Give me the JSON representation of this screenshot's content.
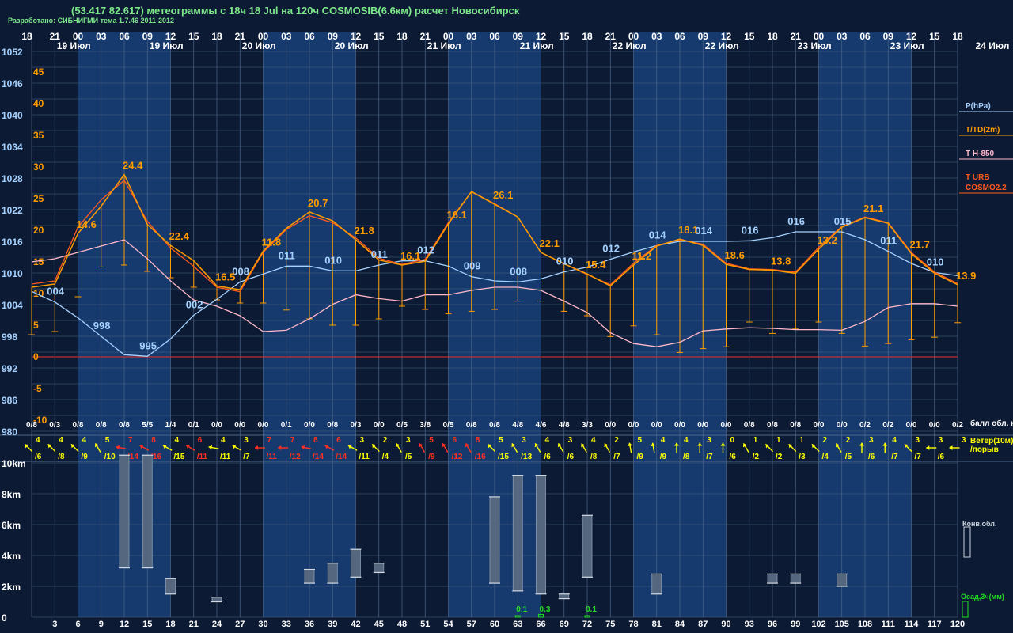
{
  "header": {
    "title": "(53.417 82.617) метеограммы с  18ч 18 Jul на 120ч COSMOSIB(6.6км) расчет Новосибирск",
    "credit": "Разработано: СИБНИГМИ тема 1.7.46 2011-2012"
  },
  "colors": {
    "background": "#0d1a33",
    "band": "#163a6e",
    "grid": "#4d6688",
    "pressure": "#a6d2ff",
    "temperature": "#ff9c00",
    "t850": "#ffb8c8",
    "zero_line": "#c03030",
    "wind_normal": "#ffff00",
    "wind_strong": "#ff3020",
    "precip": "#20e020",
    "text": "#ffffff"
  },
  "chart_data": [
    {
      "name": "meteogram-upper",
      "type": "line",
      "hour_labels": [
        "18",
        "21",
        "00",
        "03",
        "06",
        "09",
        "12",
        "15",
        "18",
        "21",
        "00",
        "03",
        "06",
        "09",
        "12",
        "15",
        "18",
        "21",
        "00",
        "03",
        "06",
        "09",
        "12",
        "15",
        "18",
        "21",
        "00",
        "03",
        "06",
        "09",
        "12",
        "15",
        "18",
        "21",
        "00",
        "03",
        "06",
        "09",
        "12",
        "15",
        "18"
      ],
      "date_labels": [
        "19 Июл",
        "19 Июл",
        "20 Июл",
        "20 Июл",
        "21 Июл",
        "21 Июл",
        "22 Июл",
        "22 Июл",
        "23 Июл",
        "23 Июл",
        "24 Июл"
      ],
      "pressure_ticks": [
        "1052",
        "1046",
        "1040",
        "1034",
        "1028",
        "1022",
        "1016",
        "1010",
        "1004",
        "998",
        "992",
        "986",
        "980"
      ],
      "temperature_ticks": [
        "45",
        "40",
        "35",
        "30",
        "25",
        "20",
        "15",
        "10",
        "5",
        "0",
        "-5",
        "-10"
      ],
      "lead_hours": [
        0,
        3,
        6,
        9,
        12,
        15,
        18,
        21,
        24,
        27,
        30,
        33,
        36,
        39,
        42,
        45,
        48,
        51,
        54,
        57,
        60,
        63,
        66,
        69,
        72,
        75,
        78,
        81,
        84,
        87,
        90,
        93,
        96,
        99,
        102,
        105,
        108,
        111,
        114,
        117,
        120
      ],
      "series": [
        {
          "key": "pressure",
          "unit": "hPa",
          "values": [
            1006.5,
            1004.5,
            1001.5,
            998,
            994.5,
            994.2,
            997.5,
            1002,
            1005,
            1008.3,
            1009.8,
            1011.3,
            1011.3,
            1010.4,
            1010.4,
            1011.5,
            1012.3,
            1012.3,
            1011.3,
            1009.3,
            1008.5,
            1008.3,
            1008.9,
            1010.2,
            1011.1,
            1012.6,
            1014,
            1015.2,
            1016,
            1016,
            1016,
            1016.1,
            1016.7,
            1017.8,
            1017.8,
            1017.8,
            1016.3,
            1014.1,
            1011.8,
            1010.1,
            1009.5
          ],
          "labels": [
            {
              "i": 1,
              "t": "004"
            },
            {
              "i": 3,
              "t": "998"
            },
            {
              "i": 5,
              "t": "995"
            },
            {
              "i": 7,
              "t": "002"
            },
            {
              "i": 9,
              "t": "008"
            },
            {
              "i": 11,
              "t": "011"
            },
            {
              "i": 13,
              "t": "010"
            },
            {
              "i": 15,
              "t": "011"
            },
            {
              "i": 17,
              "t": "012"
            },
            {
              "i": 19,
              "t": "009"
            },
            {
              "i": 21,
              "t": "008"
            },
            {
              "i": 23,
              "t": "010"
            },
            {
              "i": 25,
              "t": "012"
            },
            {
              "i": 27,
              "t": "014"
            },
            {
              "i": 29,
              "t": "014"
            },
            {
              "i": 31,
              "t": "016"
            },
            {
              "i": 33,
              "t": "016"
            },
            {
              "i": 35,
              "t": "015"
            },
            {
              "i": 37,
              "t": "011"
            },
            {
              "i": 39,
              "t": "010"
            }
          ]
        },
        {
          "key": "temperature",
          "name": "T/TD(2m)",
          "unit": "C",
          "values": [
            11,
            11.5,
            19.5,
            23.8,
            28.8,
            20.9,
            17.6,
            15.2,
            11.2,
            10.6,
            16.7,
            20.3,
            22.9,
            21.5,
            18.5,
            15.3,
            14.5,
            15.1,
            21,
            26.1,
            24.1,
            22.1,
            16.5,
            14.7,
            13.1,
            11.2,
            14.5,
            17.5,
            18.6,
            17.6,
            14.6,
            13.8,
            13.7,
            13.2,
            17,
            20.5,
            22,
            21.1,
            16.3,
            13.2,
            11.4
          ],
          "labels": [
            {
              "i": 2,
              "t": "14.6"
            },
            {
              "i": 4,
              "t": "24.4"
            },
            {
              "i": 6,
              "t": "22.4"
            },
            {
              "i": 8,
              "t": "16.5"
            },
            {
              "i": 10,
              "t": "11.8"
            },
            {
              "i": 12,
              "t": "20.7"
            },
            {
              "i": 14,
              "t": "21.8"
            },
            {
              "i": 16,
              "t": "16.1"
            },
            {
              "i": 18,
              "t": "16.1"
            },
            {
              "i": 20,
              "t": "26.1"
            },
            {
              "i": 22,
              "t": "22.1"
            },
            {
              "i": 24,
              "t": "15.4"
            },
            {
              "i": 26,
              "t": "11.2"
            },
            {
              "i": 28,
              "t": "18.1"
            },
            {
              "i": 30,
              "t": "18.6"
            },
            {
              "i": 32,
              "t": "13.8"
            },
            {
              "i": 34,
              "t": "13.2"
            },
            {
              "i": 36,
              "t": "21.1"
            },
            {
              "i": 38,
              "t": "21.7"
            },
            {
              "i": 40,
              "t": "13.9"
            }
          ]
        },
        {
          "key": "t_urb",
          "name": "T URB",
          "unit": "C",
          "values": [
            11.5,
            12,
            20.5,
            24.8,
            27.9,
            21.4,
            17.2,
            14.3,
            11,
            10.3,
            16.5,
            20.1,
            22.3,
            21.2,
            18.8,
            15.6,
            14.6,
            15.4,
            21.2,
            26.1,
            24.2,
            22.1,
            16.5,
            14.7,
            13,
            11.4,
            14.8,
            17.6,
            18.5,
            17.8,
            14.8,
            13.9,
            13.8,
            13.4,
            17.3,
            20.6,
            22.1,
            21.2,
            16.5,
            13.4,
            11.6
          ]
        },
        {
          "key": "t850",
          "name": "T H-850",
          "unit": "C",
          "values": [
            15,
            15.5,
            16.5,
            17.5,
            18.5,
            15.5,
            12,
            9,
            8,
            6.5,
            4,
            4.2,
            6,
            8.3,
            9.8,
            9.2,
            8.8,
            9.8,
            9.8,
            10.5,
            11,
            11,
            10.5,
            8.8,
            7,
            3.8,
            2.1,
            1.6,
            2.3,
            4.1,
            4.4,
            4.6,
            4.5,
            4.3,
            4.3,
            4.2,
            5.6,
            7.8,
            8.4,
            8.4,
            8
          ]
        },
        {
          "key": "dew_point",
          "name": "TD",
          "unit": "C",
          "values": [
            3.5,
            4,
            9.5,
            14.2,
            14.5,
            13.5,
            12.5,
            11,
            9,
            8.5,
            8.5,
            7.4,
            6,
            5,
            5,
            6,
            8,
            7.5,
            6.8,
            7.2,
            7.5,
            8.8,
            8.8,
            7.2,
            6.5,
            3.2,
            4.9,
            3.5,
            0.7,
            1.3,
            1.6,
            5.5,
            3.7,
            4.4,
            5.5,
            3.7,
            1.7,
            2.1,
            2.7,
            3.1,
            5.4
          ]
        }
      ],
      "legend": [
        "P(hPa)",
        "T/TD(2m)",
        "T H-850",
        "T URB",
        "COSMO2.2"
      ],
      "ylim_pressure": [
        980,
        1055
      ],
      "ylim_temperature": [
        -10,
        45
      ]
    },
    {
      "name": "cloud-and-wind",
      "type": "table",
      "cloud_cover": [
        "0/8",
        "0/3",
        "0/8",
        "0/8",
        "0/8",
        "5/5",
        "1/4",
        "0/1",
        "0/0",
        "0/0",
        "0/0",
        "0/1",
        "0/0",
        "0/8",
        "0/3",
        "0/0",
        "0/5",
        "3/8",
        "0/5",
        "0/8",
        "0/8",
        "4/8",
        "4/6",
        "4/8",
        "3/3",
        "0/0",
        "0/0",
        "0/0",
        "0/0",
        "0/0",
        "0/0",
        "0/8",
        "0/8",
        "0/8",
        "0/0",
        "0/0",
        "0/2",
        "0/2",
        "0/0",
        "0/0",
        "0/2"
      ],
      "cloud_label": "балл обл. ниж/общ",
      "wind_speed": [
        "4",
        "4",
        "4",
        "5",
        "7",
        "8",
        "4",
        "6",
        "4",
        "3",
        "7",
        "7",
        "8",
        "6",
        "3",
        "2",
        "3",
        "5",
        "6",
        "8",
        "5",
        "3",
        "4",
        "3",
        "4",
        "2",
        "5",
        "4",
        "4",
        "3",
        "0",
        "1",
        "1",
        "1",
        "2",
        "2",
        "3",
        "4",
        "3",
        "3",
        "3"
      ],
      "wind_gust": [
        "/6",
        "/8",
        "/9",
        "/10",
        "/14",
        "/16",
        "/15",
        "/11",
        "/11",
        "/7",
        "/11",
        "/12",
        "/14",
        "/14",
        "/11",
        "/4",
        "/5",
        "/9",
        "/12",
        "/16",
        "/15",
        "/13",
        "/6",
        "/6",
        "/8",
        "/7",
        "/9",
        "/9",
        "/8",
        "/7",
        "/6",
        "/2",
        "/2",
        "/3",
        "/4",
        "/5",
        "/6",
        "/7",
        "/7",
        "/6"
      ],
      "wind_dir_deg": [
        315,
        315,
        315,
        330,
        280,
        300,
        300,
        300,
        280,
        300,
        270,
        270,
        280,
        300,
        300,
        315,
        330,
        330,
        330,
        330,
        315,
        330,
        330,
        330,
        330,
        330,
        350,
        350,
        0,
        0,
        0,
        330,
        315,
        315,
        315,
        330,
        0,
        0,
        315,
        270,
        270
      ],
      "wind_strong": [
        0,
        0,
        0,
        0,
        1,
        1,
        0,
        1,
        0,
        0,
        1,
        1,
        1,
        1,
        0,
        0,
        0,
        1,
        1,
        1,
        0,
        0,
        0,
        0,
        0,
        0,
        0,
        0,
        0,
        0,
        0,
        0,
        0,
        0,
        0,
        0,
        0,
        0,
        0,
        0,
        0
      ],
      "wind_label": "Ветер(10м) /порыв"
    },
    {
      "name": "convective-clouds",
      "type": "bar",
      "height_ticks": [
        "10km",
        "8km",
        "6km",
        "4km",
        "2km",
        "0"
      ],
      "step_labels": [
        "3",
        "6",
        "9",
        "12",
        "15",
        "18",
        "21",
        "24",
        "27",
        "30",
        "33",
        "36",
        "39",
        "42",
        "45",
        "48",
        "51",
        "54",
        "57",
        "60",
        "63",
        "66",
        "69",
        "72",
        "75",
        "78",
        "81",
        "84",
        "87",
        "90",
        "93",
        "96",
        "99",
        "102",
        "105",
        "108",
        "111",
        "114",
        "117",
        "120"
      ],
      "clouds": [
        {
          "hour": 12,
          "base_km": 3.2,
          "top_km": 10.5
        },
        {
          "hour": 15,
          "base_km": 3.2,
          "top_km": 10.5
        },
        {
          "hour": 18,
          "base_km": 1.5,
          "top_km": 2.5
        },
        {
          "hour": 24,
          "base_km": 1,
          "top_km": 1.3
        },
        {
          "hour": 36,
          "base_km": 2.2,
          "top_km": 3.1
        },
        {
          "hour": 39,
          "base_km": 2.2,
          "top_km": 3.5
        },
        {
          "hour": 42,
          "base_km": 2.6,
          "top_km": 4.4
        },
        {
          "hour": 45,
          "base_km": 2.9,
          "top_km": 3.5
        },
        {
          "hour": 60,
          "base_km": 2.2,
          "top_km": 7.8
        },
        {
          "hour": 63,
          "base_km": 1.7,
          "top_km": 9.2
        },
        {
          "hour": 66,
          "base_km": 1.5,
          "top_km": 9.2
        },
        {
          "hour": 69,
          "base_km": 1.2,
          "top_km": 1.5
        },
        {
          "hour": 72,
          "base_km": 2.6,
          "top_km": 6.6
        },
        {
          "hour": 81,
          "base_km": 1.5,
          "top_km": 2.8
        },
        {
          "hour": 96,
          "base_km": 2.2,
          "top_km": 2.8
        },
        {
          "hour": 99,
          "base_km": 2.2,
          "top_km": 2.8
        },
        {
          "hour": 105,
          "base_km": 2,
          "top_km": 2.8
        }
      ],
      "precip": [
        {
          "hour": 63,
          "mm": "0.1"
        },
        {
          "hour": 66,
          "mm": "0.3"
        },
        {
          "hour": 72,
          "mm": "0.1"
        }
      ],
      "legend_conv": "Конв.обл.",
      "legend_precip": "Осад,3ч(мм)"
    }
  ]
}
